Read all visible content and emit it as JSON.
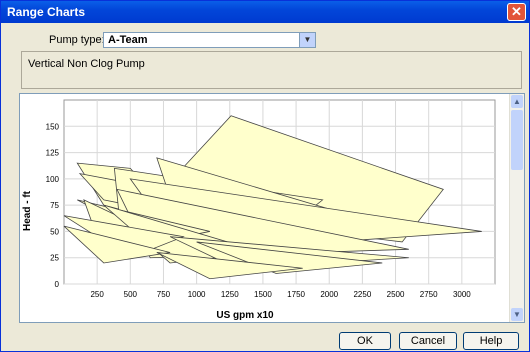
{
  "window": {
    "title": "Range Charts",
    "close_glyph": "✕"
  },
  "pump": {
    "label": "Pump type:",
    "value": "A-Team"
  },
  "description": "Vertical Non Clog Pump",
  "buttons": {
    "ok": "OK",
    "cancel": "Cancel",
    "help": "Help"
  },
  "chart_data": {
    "type": "area",
    "xlabel": "US gpm x10",
    "ylabel": "Head - ft",
    "xlim": [
      0,
      3250
    ],
    "ylim": [
      0,
      175
    ],
    "xticks": [
      250,
      500,
      750,
      1000,
      1250,
      1500,
      1750,
      2000,
      2250,
      2500,
      2750,
      3000
    ],
    "yticks": [
      0,
      25,
      50,
      75,
      100,
      125,
      150
    ],
    "grid": true,
    "fill": "#ffffcc",
    "stroke": "#444444",
    "series": [
      {
        "points": [
          [
            1260,
            160
          ],
          [
            2860,
            90
          ],
          [
            2550,
            40
          ],
          [
            600,
            70
          ]
        ]
      },
      {
        "points": [
          [
            100,
            115
          ],
          [
            500,
            110
          ],
          [
            900,
            55
          ],
          [
            300,
            75
          ]
        ]
      },
      {
        "points": [
          [
            120,
            105
          ],
          [
            1800,
            65
          ],
          [
            1900,
            40
          ],
          [
            300,
            80
          ]
        ]
      },
      {
        "points": [
          [
            380,
            110
          ],
          [
            1950,
            80
          ],
          [
            1700,
            55
          ],
          [
            420,
            60
          ]
        ]
      },
      {
        "points": [
          [
            700,
            120
          ],
          [
            2300,
            60
          ],
          [
            900,
            45
          ]
        ]
      },
      {
        "points": [
          [
            500,
            100
          ],
          [
            3150,
            50
          ],
          [
            900,
            30
          ]
        ]
      },
      {
        "points": [
          [
            400,
            90
          ],
          [
            2600,
            33
          ],
          [
            650,
            25
          ]
        ]
      },
      {
        "points": [
          [
            100,
            80
          ],
          [
            1100,
            50
          ],
          [
            700,
            40
          ]
        ]
      },
      {
        "points": [
          [
            150,
            80
          ],
          [
            900,
            35
          ],
          [
            300,
            27
          ]
        ]
      },
      {
        "points": [
          [
            300,
            75
          ],
          [
            1500,
            30
          ],
          [
            800,
            20
          ]
        ]
      },
      {
        "points": [
          [
            0,
            65
          ],
          [
            900,
            45
          ],
          [
            500,
            25
          ]
        ]
      },
      {
        "points": [
          [
            0,
            55
          ],
          [
            800,
            30
          ],
          [
            300,
            20
          ]
        ]
      },
      {
        "points": [
          [
            800,
            45
          ],
          [
            2600,
            25
          ],
          [
            1300,
            15
          ]
        ]
      },
      {
        "points": [
          [
            1000,
            40
          ],
          [
            2400,
            20
          ],
          [
            1600,
            10
          ]
        ]
      },
      {
        "points": [
          [
            700,
            30
          ],
          [
            1800,
            15
          ],
          [
            1100,
            5
          ]
        ]
      }
    ]
  }
}
